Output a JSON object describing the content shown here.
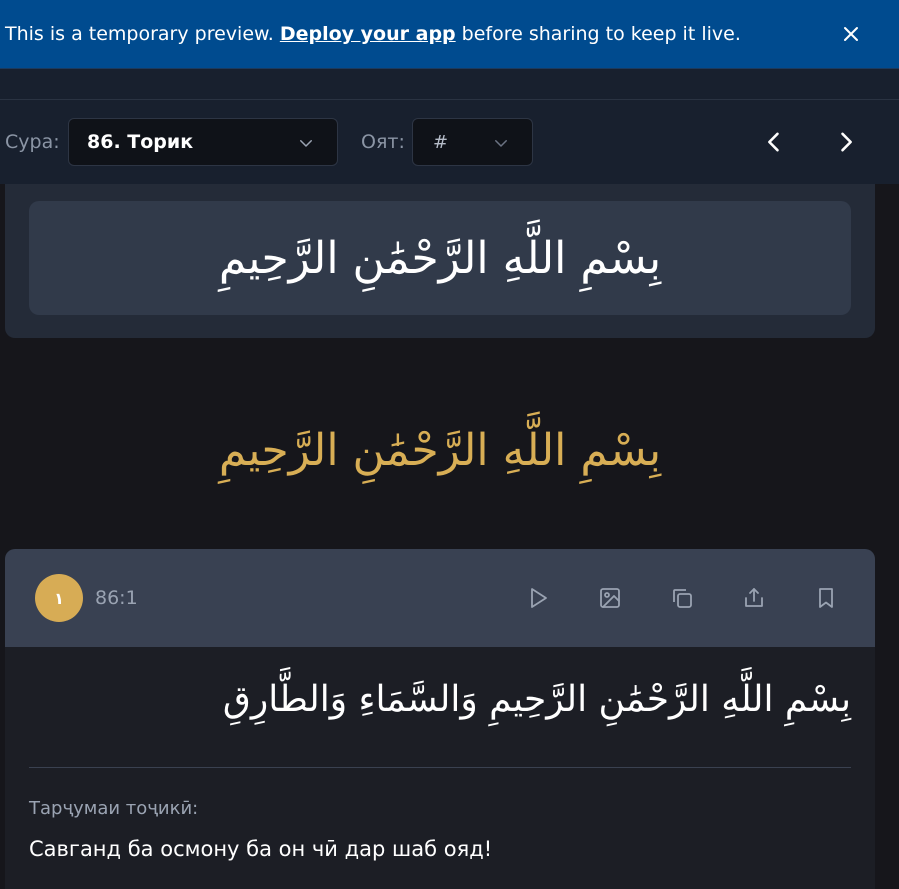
{
  "banner": {
    "text_before": "This is a temporary preview.",
    "link": "Deploy your app",
    "text_after": "before sharing to keep it live.",
    "close_icon": "close-icon"
  },
  "nav": {
    "sura_label": "Сура:",
    "sura_value": "86. Торик",
    "ayat_label": "Оят:",
    "ayat_value": "#",
    "prev_icon": "chevron-left-icon",
    "next_icon": "chevron-right-icon"
  },
  "bismillah": {
    "card_text": "بِسْمِ اللَّهِ الرَّحْمَٰنِ الرَّحِيمِ",
    "gold_text": "بِسْمِ اللَّهِ الرَّحْمَٰنِ الرَّحِيمِ"
  },
  "verse": {
    "number": "١",
    "reference": "86:1",
    "arabic": "بِسْمِ اللَّهِ الرَّحْمَٰنِ الرَّحِيمِ وَالسَّمَاءِ وَالطَّارِقِ",
    "translation_label": "Тарҷумаи тоҷикӣ:",
    "translation": "Савганд ба осмону ба он чӣ дар шаб ояд!",
    "actions": [
      "play-icon",
      "image-icon",
      "copy-icon",
      "share-icon",
      "bookmark-icon"
    ]
  },
  "colors": {
    "banner_bg": "#004b8f",
    "page_bg": "#16161b",
    "nav_bg": "#18202e",
    "gold": "#d8ae55"
  }
}
